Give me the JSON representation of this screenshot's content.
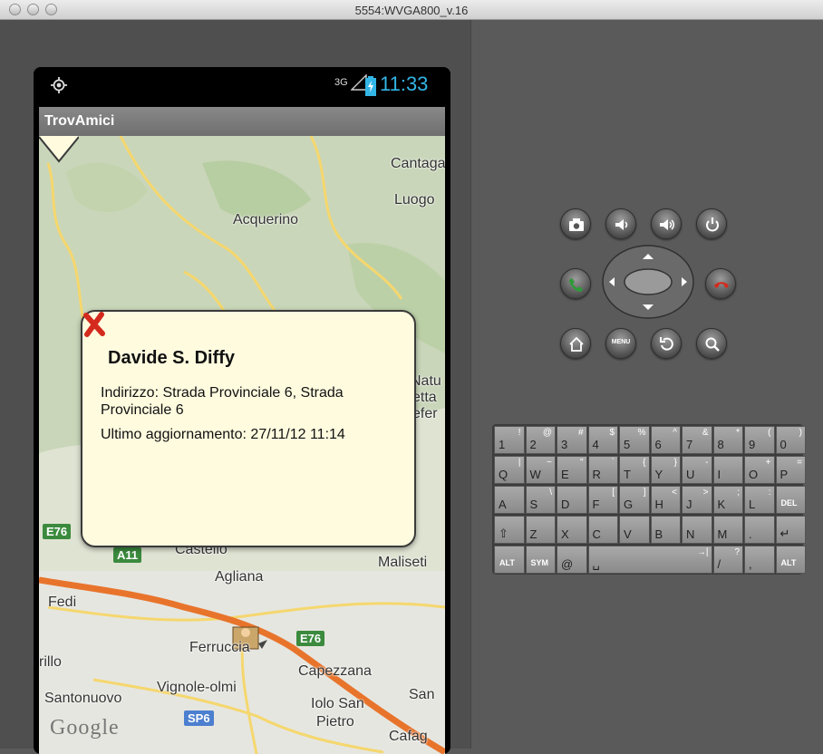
{
  "window": {
    "title": "5554:WVGA800_v.16"
  },
  "status_bar": {
    "network": "3G",
    "time": "11:33"
  },
  "app": {
    "title": "TrovAmici"
  },
  "map": {
    "places": [
      "Cantaga",
      "Luogo",
      "Acquerino",
      "Natu",
      "etta",
      "efer",
      "Castello",
      "Agliana",
      "Maliseti",
      "Fedi",
      "Ferruccia",
      "rillo",
      "Capezzana",
      "San",
      "Vignole-olmi",
      "Santonuovo",
      "Iolo San",
      "Pietro",
      "Cafag"
    ],
    "shields": [
      "E76",
      "A11",
      "E76",
      "SP6"
    ],
    "attribution": "Google"
  },
  "popup": {
    "name": "Davide S. Diffy",
    "address": "Indirizzo: Strada Provinciale 6, Strada Provinciale 6",
    "last_update": "Ultimo aggiornamento: 27/11/12 11:14"
  },
  "controls": {
    "menu_label": "MENU"
  },
  "keyboard": {
    "row1": [
      [
        "1",
        "!"
      ],
      [
        "2",
        "@"
      ],
      [
        "3",
        "#"
      ],
      [
        "4",
        "$"
      ],
      [
        "5",
        "%"
      ],
      [
        "6",
        "^"
      ],
      [
        "7",
        "&"
      ],
      [
        "8",
        "*"
      ],
      [
        "9",
        "("
      ],
      [
        "0",
        ")"
      ]
    ],
    "row2": [
      [
        "Q",
        "|"
      ],
      [
        "W",
        "~"
      ],
      [
        "E",
        "\""
      ],
      [
        "R",
        "`"
      ],
      [
        "T",
        "{"
      ],
      [
        "Y",
        "}"
      ],
      [
        "U",
        "-"
      ],
      [
        "I",
        ""
      ],
      [
        "O",
        "+"
      ],
      [
        "P",
        "="
      ]
    ],
    "row3": [
      [
        "A",
        ""
      ],
      [
        "S",
        "\\"
      ],
      [
        "D",
        ""
      ],
      [
        "F",
        "["
      ],
      [
        "G",
        "]"
      ],
      [
        "H",
        "<"
      ],
      [
        "J",
        ">"
      ],
      [
        "K",
        ";"
      ],
      [
        "L",
        ":"
      ],
      [
        "DEL",
        ""
      ]
    ],
    "row4": [
      [
        "⇧",
        ""
      ],
      [
        "Z",
        ""
      ],
      [
        "X",
        ""
      ],
      [
        "C",
        ""
      ],
      [
        "V",
        ""
      ],
      [
        "B",
        ""
      ],
      [
        "N",
        ""
      ],
      [
        "M",
        ""
      ],
      [
        ".",
        ""
      ],
      [
        "↵",
        ""
      ]
    ],
    "row5": [
      [
        "ALT",
        ""
      ],
      [
        "SYM",
        ""
      ],
      [
        "@",
        ""
      ],
      [
        "␣",
        "→|"
      ],
      [
        "/",
        "?"
      ],
      [
        ",",
        ""
      ],
      [
        "ALT",
        ""
      ]
    ]
  }
}
